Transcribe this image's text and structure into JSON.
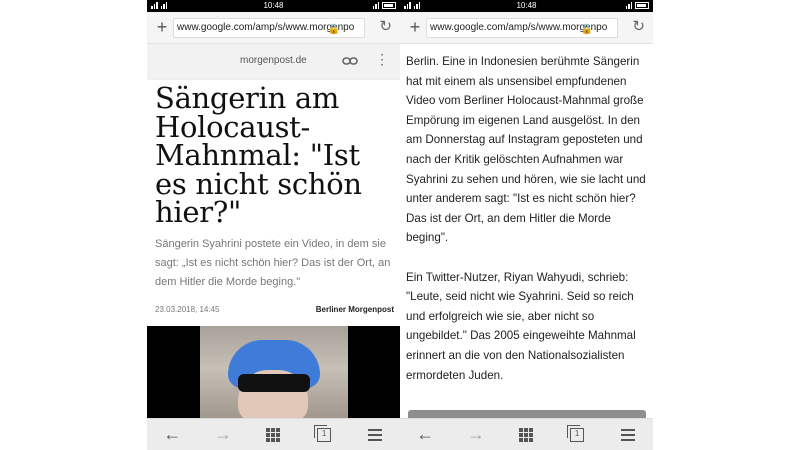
{
  "status": {
    "time": "10:48"
  },
  "left": {
    "url": "www.google.com/amp/s/www.morgenpo",
    "site": "morgenpost.de",
    "headline": "Sängerin am Holocaust-Mahnmal: \"Ist es nicht schön hier?\"",
    "subheadline": "Sängerin Syahrini postete ein Video, in dem sie sagt: „Ist es nicht schön hier? Das ist der Ort, an dem Hitler die Morde beging.\"",
    "date": "23.03.2018, 14:45",
    "source": "Berliner Morgenpost"
  },
  "right": {
    "url": "www.google.com/amp/s/www.morgenpo",
    "paragraphs": [
      "Berlin. Eine in Indonesien berühmte Sängerin hat mit einem als unsensibel empfundenen Video vom Berliner Holocaust-Mahnmal große Empörung im eigenen Land ausgelöst. In den am Donnerstag auf Instagram geposteten und nach der Kritik gelöschten Aufnahmen war Syahrini zu sehen und hören, wie sie lacht und unter anderem sagt: \"Ist es nicht schön hier? Das ist der Ort, an dem Hitler die Morde beging\".",
      "Ein Twitter-Nutzer, Riyan Wahyudi, schrieb: \"Leute, seid nicht wie Syahrini. Seid so reich und erfolgreich wie sie, aber nicht so ungebildet.\" Das 2005 eingeweihte Mahnmal erinnert an die von den Nationalsozialisten ermordeten Juden."
    ]
  },
  "bottombar": {
    "tab_count": "1"
  },
  "icons": {
    "plus": "+",
    "lock": "🔒",
    "reload": "↻",
    "link": "🔗",
    "more": "⋮",
    "back": "←",
    "forward": "→"
  }
}
